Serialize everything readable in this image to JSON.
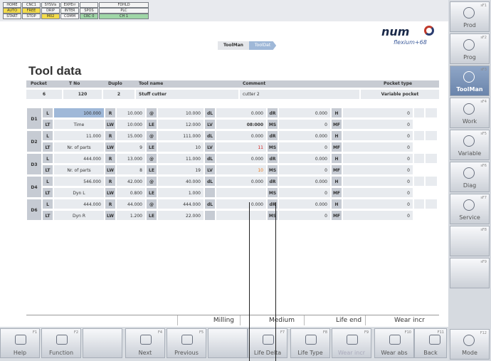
{
  "status": {
    "row1": [
      "HOME",
      "CNC1",
      "SYSVis",
      "EXPErr",
      "",
      "FDHLD"
    ],
    "row2": [
      "AUTO",
      "FREE",
      "DRIP",
      "INTER",
      "SPOS"
    ],
    "row2b": [
      "",
      "",
      "MIH",
      "/",
      "mm",
      "VALID",
      "PLC"
    ],
    "row3": [
      "START",
      "STOP",
      "M02",
      "COMM",
      "CRC 0",
      "CH 1"
    ]
  },
  "brand": {
    "logo": "num",
    "tagline": "flexium+68"
  },
  "breadcrumb": {
    "first": "ToolMan",
    "second": "ToolDat"
  },
  "page_title": "Tool data",
  "header": {
    "labels": [
      "Pocket",
      "T No",
      "Duplo",
      "Tool name",
      "Comment",
      "Pocket type"
    ],
    "values": [
      "6",
      "120",
      "2",
      "Stuff cutter",
      "cutter 2",
      "Variable pocket"
    ]
  },
  "rows": [
    {
      "d": "D1",
      "l": "L",
      "lv": "100.000",
      "r": "R",
      "rv": "10.000",
      "s": "@",
      "sv": "10.000",
      "dl": "dL",
      "dlv": "0.000",
      "dr": "dR",
      "drv": "0.000",
      "hh": "H",
      "hv": "0",
      "lt": "LT",
      "ltv": "Time",
      "lw": "LW",
      "lwv": "10:000",
      "le": "LE",
      "lev": "12:000",
      "lvl": "LV",
      "lvv": "08:000",
      "ms": "MS",
      "msv": "0",
      "mf": "MF",
      "mfv": "0"
    },
    {
      "d": "D2",
      "l": "L",
      "lv": "11.000",
      "r": "R",
      "rv": "15.000",
      "s": "@",
      "sv": "111.000",
      "dl": "dL",
      "dlv": "0.000",
      "dr": "dR",
      "drv": "0.000",
      "hh": "H",
      "hv": "0",
      "lt": "LT",
      "ltv": "Nr. of parts",
      "lw": "LW",
      "lwv": "9",
      "le": "LE",
      "lev": "10",
      "lvl": "LV",
      "lvv": "11",
      "ms": "MS",
      "msv": "0",
      "mf": "MF",
      "mfv": "0"
    },
    {
      "d": "D3",
      "l": "L",
      "lv": "444.000",
      "r": "R",
      "rv": "13.000",
      "s": "@",
      "sv": "11.000",
      "dl": "dL",
      "dlv": "0.000",
      "dr": "dR",
      "drv": "0.000",
      "hh": "H",
      "hv": "0",
      "lt": "LT",
      "ltv": "Nr. of parts",
      "lw": "LW",
      "lwv": "8",
      "le": "LE",
      "lev": "19",
      "lvl": "LV",
      "lvv": "10",
      "ms": "MS",
      "msv": "0",
      "mf": "MF",
      "mfv": "0"
    },
    {
      "d": "D4",
      "l": "L",
      "lv": "546.000",
      "r": "R",
      "rv": "42.000",
      "s": "@",
      "sv": "40.000",
      "dl": "dL",
      "dlv": "0.000",
      "dr": "dR",
      "drv": "0.000",
      "hh": "H",
      "hv": "0",
      "lt": "LT",
      "ltv": "Dyn L",
      "lw": "LW",
      "lwv": "0.800",
      "le": "LE",
      "lev": "1.000",
      "lvl": "",
      "lvv": "",
      "ms": "MS",
      "msv": "0",
      "mf": "MF",
      "mfv": "0"
    },
    {
      "d": "D6",
      "l": "L",
      "lv": "444.000",
      "r": "R",
      "rv": "44.000",
      "s": "@",
      "sv": "444.000",
      "dl": "dL",
      "dlv": "0.000",
      "dr": "dR",
      "drv": "0.000",
      "hh": "H",
      "hv": "0",
      "lt": "LT",
      "ltv": "Dyn R",
      "lw": "LW",
      "lwv": "1.200",
      "le": "LE",
      "lev": "22.000",
      "lvl": "",
      "lvv": "",
      "ms": "MS",
      "msv": "0",
      "mf": "MF",
      "mfv": "0"
    }
  ],
  "footer_status": [
    "Milling",
    "Medium",
    "Life end",
    "Wear incr"
  ],
  "fkeys": [
    {
      "label": "Help",
      "fn": "F1"
    },
    {
      "label": "Function",
      "fn": "F2"
    },
    {
      "label": "",
      "fn": ""
    },
    {
      "label": "Next",
      "fn": "F4"
    },
    {
      "label": "Previous",
      "fn": "F5"
    },
    {
      "label": "",
      "fn": ""
    },
    {
      "label": "Life Delta",
      "fn": "F7"
    },
    {
      "label": "Life Type",
      "fn": "F8"
    },
    {
      "label": "Wear incr",
      "fn": "F9"
    },
    {
      "label": "Wear abs",
      "fn": "F10"
    },
    {
      "label": "Back",
      "fn": "F11"
    }
  ],
  "skeys": [
    {
      "label": "Prod",
      "fn": "sF1"
    },
    {
      "label": "Prog",
      "fn": "sF2"
    },
    {
      "label": "ToolMan",
      "fn": "sF3"
    },
    {
      "label": "Work",
      "fn": "sF4"
    },
    {
      "label": "Variable",
      "fn": "sF5"
    },
    {
      "label": "Diag",
      "fn": "sF6"
    },
    {
      "label": "Service",
      "fn": "sF7"
    },
    {
      "label": "",
      "fn": "sF8"
    },
    {
      "label": "",
      "fn": "sF9"
    },
    {
      "label": "Mode",
      "fn": "F12"
    }
  ],
  "colors": {
    "accent": "#9fb8d8",
    "status_yellow": "#f4dc4a",
    "status_green": "#9fd6a6",
    "warn_red": "#d01818",
    "warn_orange": "#f07a18"
  }
}
